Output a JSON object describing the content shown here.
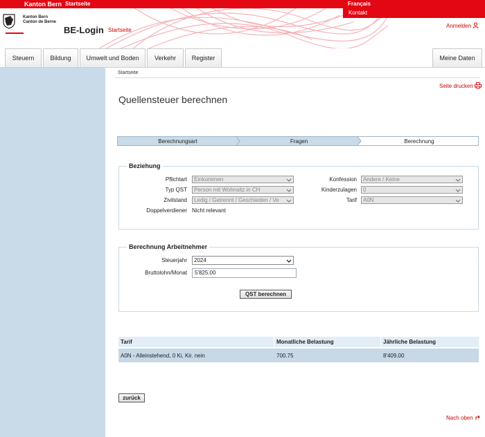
{
  "topbar": {
    "canton": "Kanton Bern",
    "startseite": "Startseite",
    "language": "Français",
    "kontakt": "Kontakt"
  },
  "header": {
    "logo_line1": "Kanton Bern",
    "logo_line2": "Canton de Berne",
    "app_title": "BE-Login",
    "startseite_link": "Startseite",
    "anmelden": "Anmelden"
  },
  "nav": {
    "tabs": [
      "Steuern",
      "Bildung",
      "Umwelt und Boden",
      "Verkehr",
      "Register"
    ],
    "meine_daten": "Meine Daten"
  },
  "breadcrumb": "Startseite",
  "print_link": "Seite drucken",
  "page_title": "Quellensteuer berechnen",
  "steps": [
    "Berechnungsart",
    "Fragen",
    "Berechnung"
  ],
  "beziehung": {
    "legend": "Beziehung",
    "pflichtart_label": "Pflichtart",
    "pflichtart_value": "Einkommen",
    "typqst_label": "Typ QST",
    "typqst_value": "Person mit Wohnsitz in CH",
    "zivilstand_label": "Zivilstand",
    "zivilstand_value": "Ledig / Getrennt / Geschieden / Ve",
    "doppelverdiener_label": "Doppelverdiener",
    "doppelverdiener_value": "Nicht relevant",
    "konfession_label": "Konfession",
    "konfession_value": "Andere / Keine",
    "kinderzulagen_label": "Kinderzulagen",
    "kinderzulagen_value": "0",
    "tarif_label": "Tarif",
    "tarif_value": "A0N"
  },
  "arbeitnehmer": {
    "legend": "Berechnung Arbeitnehmer",
    "steuerjahr_label": "Steuerjahr",
    "steuerjahr_value": "2024",
    "bruttolohn_label": "Bruttolohn/Monat",
    "bruttolohn_value": "5'825.00",
    "button": "QST berechnen"
  },
  "result": {
    "headers": [
      "Tarif",
      "Monatliche Belastung",
      "Jährliche Belastung"
    ],
    "row": [
      "A0N - Alleinstehend, 0 Ki, Kir. nein",
      "700.75",
      "8'409.00"
    ]
  },
  "back_button": "zurück",
  "nach_oben": "Nach oben",
  "colors": {
    "brand_red": "#e30613",
    "sidebar_blue": "#c9dbe9",
    "row_blue": "#c7d8e7"
  }
}
